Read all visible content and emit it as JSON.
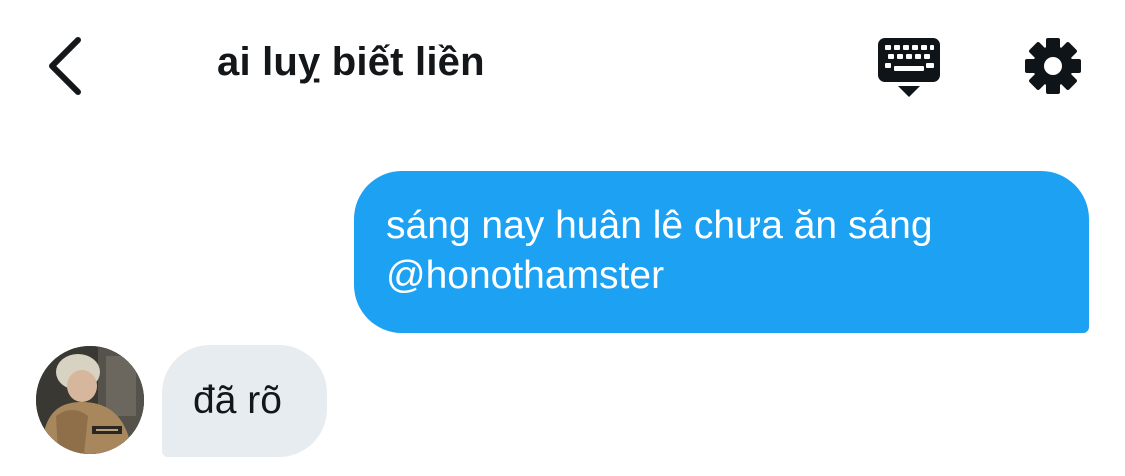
{
  "header": {
    "title": "ai luỵ biết liền",
    "back_icon": "chevron-left-icon",
    "keyboard_icon": "keyboard-icon",
    "settings_icon": "gear-icon"
  },
  "messages": [
    {
      "direction": "outgoing",
      "lines": [
        "sáng nay huân lê chưa ăn sáng",
        "@honothamster"
      ],
      "bubble_color": "#1da1f2",
      "text_color": "#ffffff"
    },
    {
      "direction": "incoming",
      "text": "đã rõ",
      "bubble_color": "#e6ecf0",
      "text_color": "#14171a"
    }
  ],
  "colors": {
    "background": "#ffffff",
    "title": "#14171a",
    "accent": "#1da1f2"
  }
}
